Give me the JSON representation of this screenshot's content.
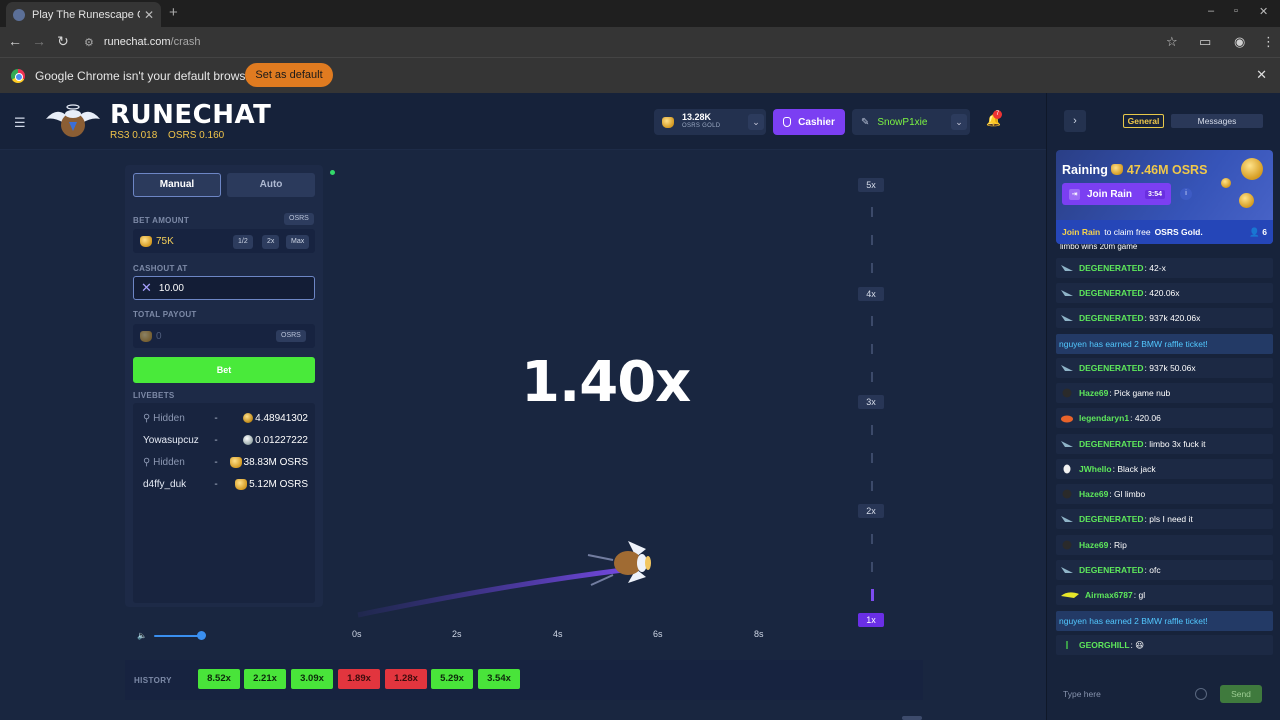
{
  "browser": {
    "tab_title": "Play The Runescape Cra",
    "tab_close": "✕",
    "new_tab": "+",
    "url_host": "runechat.com",
    "url_path": "/crash",
    "infobar_message": "Google Chrome isn't your default browser",
    "infobar_button": "Set as default",
    "infobar_close": "✕"
  },
  "header": {
    "brand": "RUNECHAT",
    "rate_rs3": "RS3 0.018",
    "rate_osrs": "OSRS 0.160",
    "balance_amount": "13.28K",
    "balance_currency": "OSRS GOLD",
    "cashier_label": "Cashier",
    "username": "SnowP1xie",
    "notification_count": "7"
  },
  "bet_panel": {
    "tab_manual": "Manual",
    "tab_auto": "Auto",
    "bet_amount_label": "BET AMOUNT",
    "bet_currency_chip": "OSRS",
    "bet_amount_value": "75K",
    "btn_half": "1/2",
    "btn_double": "2x",
    "btn_max": "Max",
    "cashout_label": "CASHOUT AT",
    "cashout_value": "10.00",
    "payout_label": "TOTAL PAYOUT",
    "payout_value": "0",
    "payout_currency_chip": "OSRS",
    "bet_button": "Bet",
    "livebets_label": "LIVEBETS",
    "livebets": [
      {
        "name": "Hidden",
        "hidden": true,
        "sep": "-",
        "value": "4.48941302",
        "coin": "osrs"
      },
      {
        "name": "Yowasupcuz",
        "hidden": false,
        "sep": "-",
        "value": "0.01227222",
        "coin": "rs3"
      },
      {
        "name": "Hidden",
        "hidden": true,
        "sep": "-",
        "value": "38.83M OSRS",
        "coin": "gold"
      },
      {
        "name": "d4ffy_duk",
        "hidden": false,
        "sep": "-",
        "value": "5.12M OSRS",
        "coin": "gold"
      }
    ],
    "volume_level": 0.9
  },
  "game": {
    "multiplier": "1.40x",
    "y_ticks": [
      "5x",
      "4x",
      "3x",
      "2x",
      "1x"
    ],
    "x_ticks": [
      "0s",
      "2s",
      "4s",
      "6s",
      "8s"
    ]
  },
  "history": {
    "label": "HISTORY",
    "items": [
      {
        "value": "8.52x",
        "color": "green"
      },
      {
        "value": "2.21x",
        "color": "green"
      },
      {
        "value": "3.09x",
        "color": "green"
      },
      {
        "value": "1.89x",
        "color": "red"
      },
      {
        "value": "1.28x",
        "color": "red"
      },
      {
        "value": "5.29x",
        "color": "green"
      },
      {
        "value": "3.54x",
        "color": "green"
      }
    ]
  },
  "chat": {
    "tab_general": "General",
    "tab_messages": "Messages",
    "rain_title": "Raining",
    "rain_amount": "47.46M OSRS",
    "join_rain_label": "Join Rain",
    "join_rain_timer": "3:54",
    "rain_info": "i",
    "rain_footer_link": "Join Rain",
    "rain_footer_text": "to claim free",
    "rain_footer_bold": "OSRS Gold.",
    "rain_participants": "6",
    "partial_message": "limbo wins 20m game",
    "messages": [
      {
        "user": "DEGENERATED",
        "text": "42-x",
        "avatar": "shark"
      },
      {
        "user": "DEGENERATED",
        "text": "420.06x",
        "avatar": "shark"
      },
      {
        "user": "DEGENERATED",
        "text": "937k 420.06x",
        "avatar": "shark"
      },
      {
        "system": true,
        "text": "nguyen has earned 2 BMW raffle ticket!"
      },
      {
        "user": "DEGENERATED",
        "text": "937k 50.06x",
        "avatar": "shark"
      },
      {
        "user": "Haze69",
        "text": "Pick game nub",
        "avatar": "dark"
      },
      {
        "user": "legendaryn1",
        "text": "420.06",
        "avatar": "crab"
      },
      {
        "user": "DEGENERATED",
        "text": "limbo 3x fuck it",
        "avatar": "shark"
      },
      {
        "user": "JWhello",
        "text": "Black jack",
        "avatar": "white"
      },
      {
        "user": "Haze69",
        "text": "Gl limbo",
        "avatar": "dark"
      },
      {
        "user": "DEGENERATED",
        "text": "pls I need it",
        "avatar": "shark"
      },
      {
        "user": "Haze69",
        "text": "Rip",
        "avatar": "dark"
      },
      {
        "user": "DEGENERATED",
        "text": "ofc",
        "avatar": "shark"
      },
      {
        "user": "Airmax6787",
        "text": "gl",
        "avatar": "yellow"
      },
      {
        "system": true,
        "text": "nguyen has earned 2 BMW raffle ticket!"
      },
      {
        "user": "GEORGHILL",
        "text": "😆",
        "avatar": "green"
      }
    ],
    "input_placeholder": "Type here",
    "send_label": "Send"
  },
  "colors": {
    "accent_purple": "#7b3ff2",
    "bet_green": "#49ea3a",
    "history_red": "#e2353e",
    "username_green": "#7cf542",
    "gold": "#f0c84a"
  }
}
